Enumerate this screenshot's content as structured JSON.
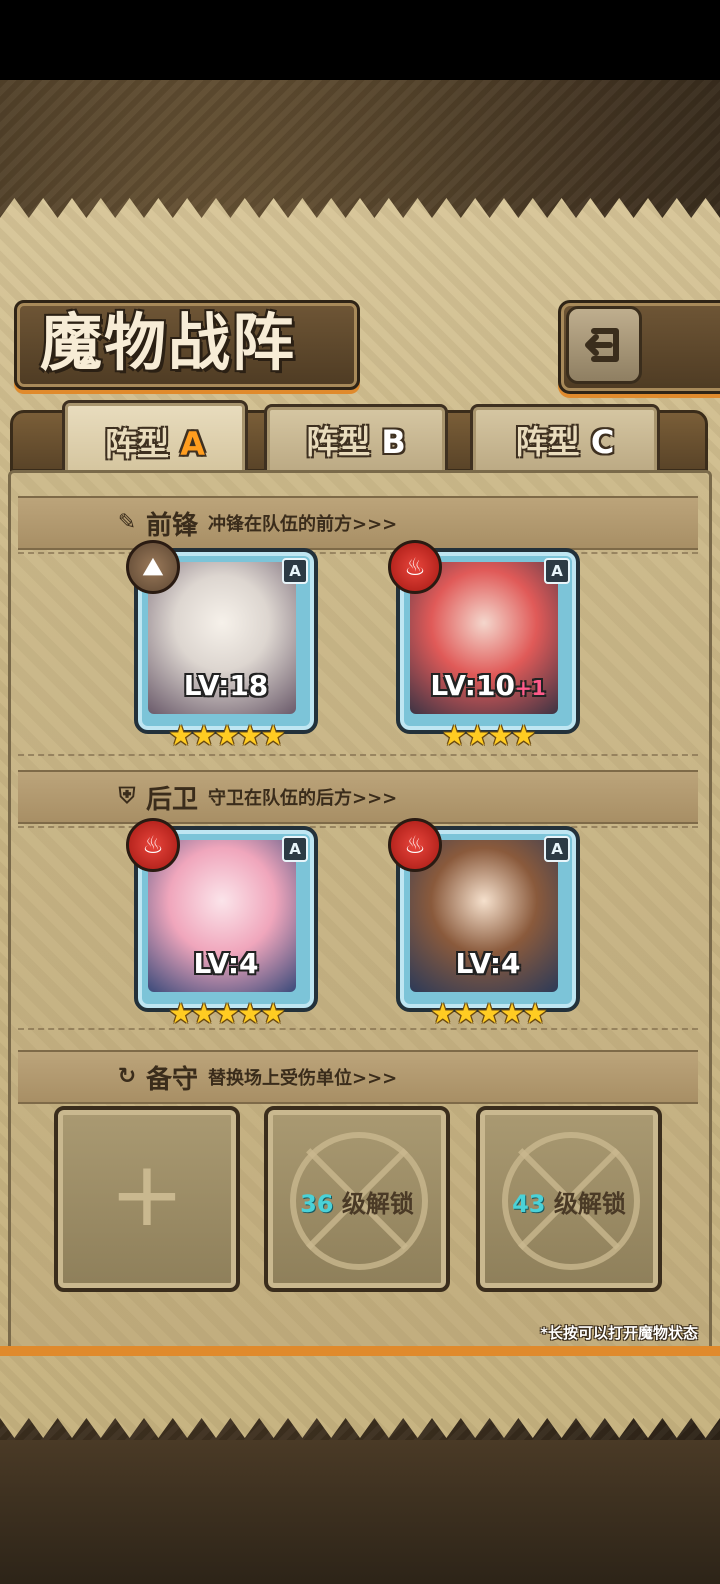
{
  "title": "魔物战阵",
  "tabs": [
    {
      "prefix": "阵型",
      "suffix": "A",
      "active": true
    },
    {
      "prefix": "阵型",
      "suffix": "B",
      "active": false
    },
    {
      "prefix": "阵型",
      "suffix": "C",
      "active": false
    }
  ],
  "sections": {
    "front": {
      "title": "前锋",
      "desc": "冲锋在队伍的前方>>>"
    },
    "back": {
      "title": "后卫",
      "desc": "守卫在队伍的后方>>>"
    },
    "reserve": {
      "title": "备守",
      "desc": "替换场上受伤单位>>>"
    }
  },
  "units": [
    {
      "level": "LV:18",
      "plus": "",
      "stars": "★★★★★",
      "grade": "A",
      "element": "earth"
    },
    {
      "level": "LV:10",
      "plus": "+1",
      "stars": "★★★★",
      "grade": "A",
      "element": "fire"
    },
    {
      "level": "LV:4",
      "plus": "",
      "stars": "★★★★★",
      "grade": "A",
      "element": "fire"
    },
    {
      "level": "LV:4",
      "plus": "",
      "stars": "★★★★★",
      "grade": "A",
      "element": "fire"
    }
  ],
  "reserve_slots": [
    {
      "type": "add",
      "label": "+"
    },
    {
      "type": "locked",
      "num": "36",
      "text": "级解锁"
    },
    {
      "type": "locked",
      "num": "43",
      "text": "级解锁"
    }
  ],
  "hint": "*长按可以打开魔物状态",
  "colors": {
    "accent": "#e08a2c",
    "fire": "#c8281e",
    "card": "#7cc4d8"
  }
}
